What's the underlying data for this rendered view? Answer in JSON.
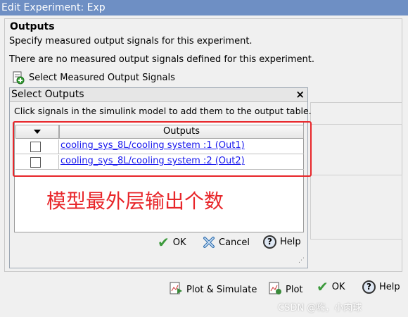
{
  "window": {
    "title": "Edit Experiment: Exp"
  },
  "outputs_section": {
    "title": "Outputs",
    "description": "Specify measured output signals for this experiment.",
    "status": "There are no measured output signals defined for this experiment.",
    "select_button_label": "Select Measured Output Signals"
  },
  "dialog": {
    "title": "Select Outputs",
    "close_symbol": "×",
    "instruction": "Click signals in the simulink model to add them to the output table.",
    "table": {
      "column_header": "Outputs",
      "rows": [
        {
          "checked": false,
          "signal": "cooling_sys_8L/cooling system :1 (Out1)"
        },
        {
          "checked": false,
          "signal": "cooling_sys_8L/cooling system :2 (Out2)"
        }
      ]
    },
    "buttons": {
      "ok": "OK",
      "cancel": "Cancel",
      "help": "Help"
    }
  },
  "annotation": {
    "text": "模型最外层输出个数",
    "color": "#e8262a"
  },
  "footer": {
    "plot_simulate": "Plot & Simulate",
    "plot": "Plot",
    "ok": "OK",
    "help": "Help"
  },
  "watermark": "CSDN @嗨，小肉球",
  "colors": {
    "title_bar": "#6e8fc4",
    "link": "#1a1aee",
    "annotation": "#e8262a",
    "check": "#3c9a3c"
  }
}
